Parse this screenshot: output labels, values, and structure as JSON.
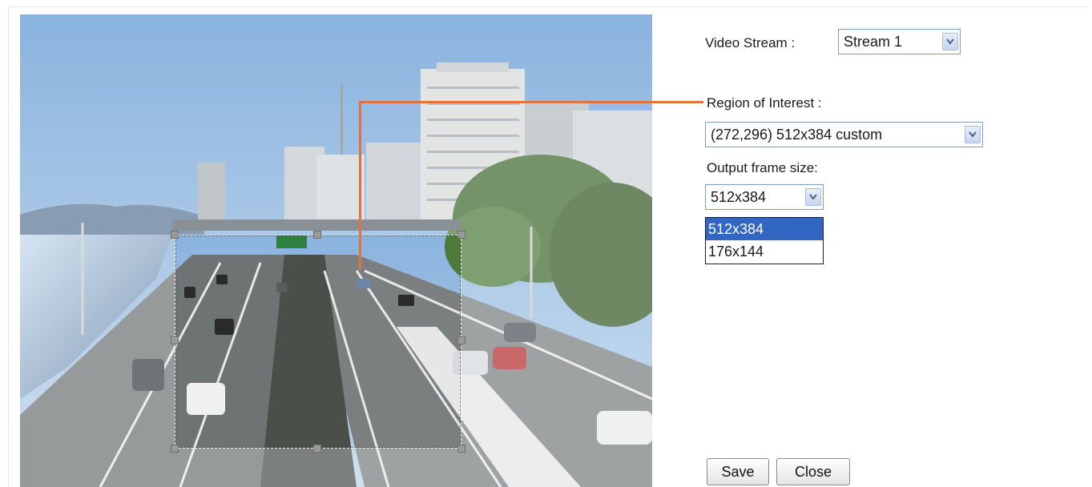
{
  "video_stream": {
    "label": "Video Stream :",
    "selected": "Stream 1"
  },
  "roi": {
    "label": "Region of Interest :",
    "selected": "(272,296) 512x384 custom"
  },
  "output_frame": {
    "label": "Output frame size:",
    "selected": "512x384",
    "options": [
      "512x384",
      "176x144"
    ],
    "highlighted": "512x384"
  },
  "buttons": {
    "save": "Save",
    "close": "Close"
  },
  "colors": {
    "callout": "#e0733f",
    "highlight": "#3166c3",
    "select_border": "#7f9db9"
  },
  "camera_view": {
    "scene": "highway overpass with city buildings"
  }
}
